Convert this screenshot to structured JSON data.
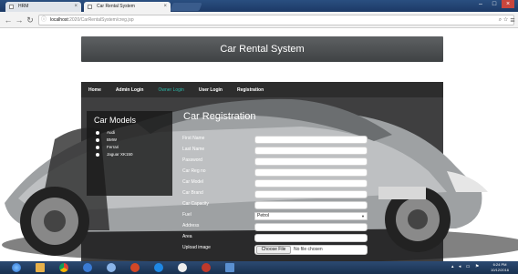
{
  "browser": {
    "tabs": [
      {
        "label": "HRM"
      },
      {
        "label": "Car Rental System"
      }
    ],
    "address": {
      "host": "localhost",
      "path": ":2020/CarRentalSystem/creg.jsp"
    }
  },
  "site": {
    "title": "Car Rental System",
    "nav": [
      "Home",
      "Admin Login",
      "Owner Login",
      "User Login",
      "Registration"
    ],
    "active_nav": "Owner Login"
  },
  "sidebar": {
    "title": "Car Models",
    "items": [
      "Audi",
      "BMW",
      "Ferrari",
      "Jaguar XK150"
    ]
  },
  "form": {
    "title": "Car Registration",
    "labels": [
      "First Name",
      "Last Name",
      "Password",
      "Car Reg no",
      "Car Model",
      "Car Brand",
      "Car Capacity",
      "Fuel",
      "Address",
      "Area",
      "Upload image"
    ],
    "fuel_selected": "Petrol",
    "file_button": "Choose File",
    "file_status": "No file chosen"
  },
  "taskbar": {
    "time": "6:24 PM",
    "date": "10/12/2016"
  },
  "colors": {
    "accent": "#2cb9a9",
    "header": "#505354",
    "nav": "#2d2d2d"
  }
}
